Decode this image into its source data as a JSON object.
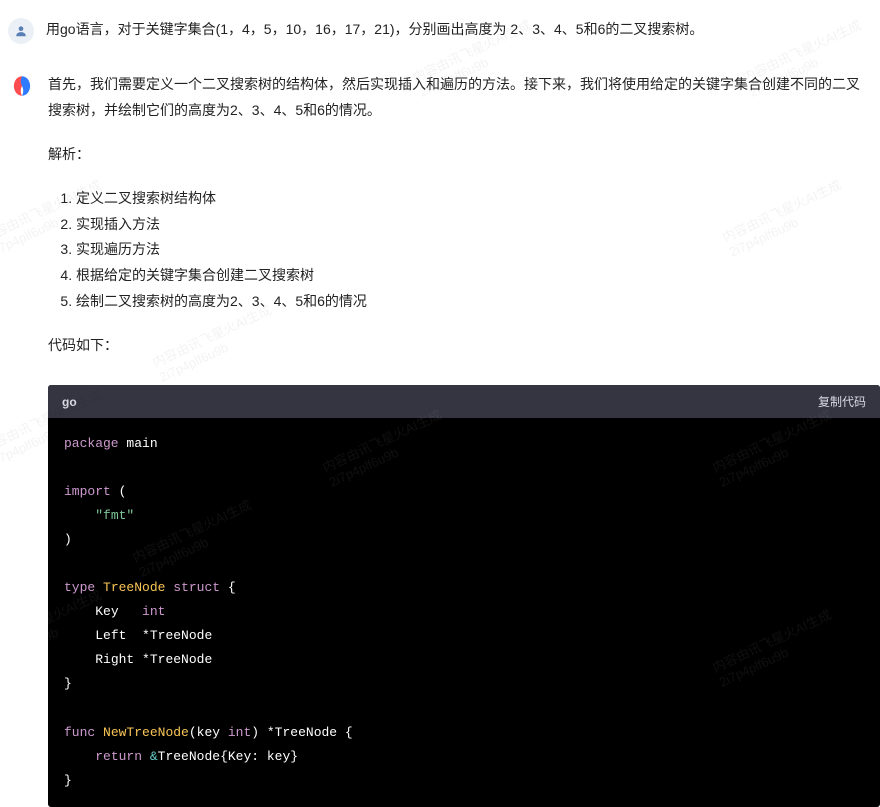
{
  "question": "用go语言，对于关键字集合(1，4，5，10，16，17，21)，分别画出高度为 2、3、4、5和6的二叉搜索树。",
  "answer": {
    "intro": "首先，我们需要定义一个二叉搜索树的结构体，然后实现插入和遍历的方法。接下来，我们将使用给定的关键字集合创建不同的二叉搜索树，并绘制它们的高度为2、3、4、5和6的情况。",
    "analysis_label": "解析：",
    "steps": [
      "定义二叉搜索树结构体",
      "实现插入方法",
      "实现遍历方法",
      "根据给定的关键字集合创建二叉搜索树",
      "绘制二叉搜索树的高度为2、3、4、5和6的情况"
    ],
    "code_label": "代码如下："
  },
  "code": {
    "lang": "go",
    "copy_label": "复制代码",
    "lines": {
      "l1_kw": "package",
      "l1_pkg": "main",
      "l3_kw": "import",
      "l3_paren": "(",
      "l4_str": "\"fmt\"",
      "l5_paren": ")",
      "l7_kw": "type",
      "l7_name": "TreeNode",
      "l7_struct": "struct",
      "l7_brace": "{",
      "l8_field": "Key",
      "l8_type": "int",
      "l9_field": "Left",
      "l9_ptr": "*TreeNode",
      "l10_field": "Right",
      "l10_ptr": "*TreeNode",
      "l11_brace": "}",
      "l13_kw": "func",
      "l13_name": "NewTreeNode",
      "l13_sig1": "(key ",
      "l13_int": "int",
      "l13_sig2": ") *TreeNode {",
      "l14_kw": "return",
      "l14_amp": "&",
      "l14_rest": "TreeNode{Key: key}",
      "l15_brace": "}"
    }
  },
  "watermark": {
    "line1": "内容由讯飞星火AI生成",
    "line2": "2i7p4plf6u9b"
  }
}
